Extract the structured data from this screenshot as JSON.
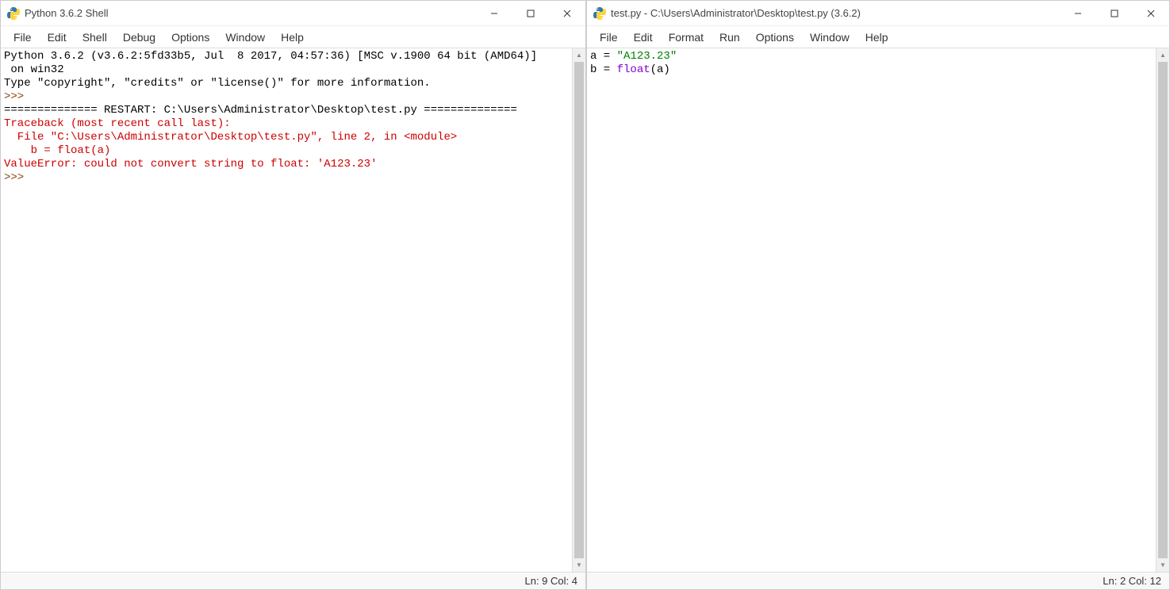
{
  "shell_window": {
    "title": "Python 3.6.2 Shell",
    "menus": [
      "File",
      "Edit",
      "Shell",
      "Debug",
      "Options",
      "Window",
      "Help"
    ],
    "header_line1": "Python 3.6.2 (v3.6.2:5fd33b5, Jul  8 2017, 04:57:36) [MSC v.1900 64 bit (AMD64)]",
    "header_line2": " on win32",
    "copyright_line": "Type \"copyright\", \"credits\" or \"license()\" for more information.",
    "prompt1": ">>>",
    "restart_line": "============== RESTART: C:\\Users\\Administrator\\Desktop\\test.py ==============",
    "traceback_line1": "Traceback (most recent call last):",
    "traceback_line2": "  File \"C:\\Users\\Administrator\\Desktop\\test.py\", line 2, in <module>",
    "traceback_line3": "    b = float(a)",
    "traceback_line4": "ValueError: could not convert string to float: 'A123.23'",
    "prompt2": ">>> ",
    "status": "Ln: 9  Col: 4"
  },
  "editor_window": {
    "title": "test.py - C:\\Users\\Administrator\\Desktop\\test.py (3.6.2)",
    "menus": [
      "File",
      "Edit",
      "Format",
      "Run",
      "Options",
      "Window",
      "Help"
    ],
    "code_line1_pre": "a = ",
    "code_line1_str": "\"A123.23\"",
    "code_line2_pre": "b = ",
    "code_line2_fn": "float",
    "code_line2_post": "(a)",
    "status": "Ln: 2  Col: 12"
  }
}
